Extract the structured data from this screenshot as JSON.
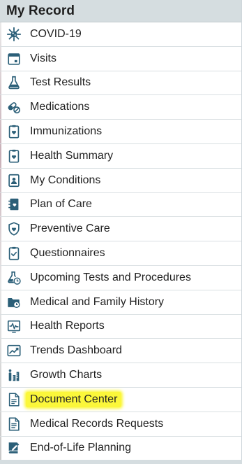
{
  "header": {
    "title": "My Record"
  },
  "colors": {
    "icon": "#2b5f78",
    "highlight": "#fbf73a",
    "header_bg": "#d5dde0"
  },
  "items": [
    {
      "label": "COVID-19",
      "icon": "virus-icon"
    },
    {
      "label": "Visits",
      "icon": "calendar-icon"
    },
    {
      "label": "Test Results",
      "icon": "flask-icon"
    },
    {
      "label": "Medications",
      "icon": "pills-icon"
    },
    {
      "label": "Immunizations",
      "icon": "clipboard-heart-icon"
    },
    {
      "label": "Health Summary",
      "icon": "clipboard-heart-icon"
    },
    {
      "label": "My Conditions",
      "icon": "person-card-icon"
    },
    {
      "label": "Plan of Care",
      "icon": "notebook-heart-icon"
    },
    {
      "label": "Preventive Care",
      "icon": "shield-heart-icon"
    },
    {
      "label": "Questionnaires",
      "icon": "checklist-icon"
    },
    {
      "label": "Upcoming Tests and Procedures",
      "icon": "flask-clock-icon"
    },
    {
      "label": "Medical and Family History",
      "icon": "folder-clock-icon"
    },
    {
      "label": "Health Reports",
      "icon": "pulse-chart-icon"
    },
    {
      "label": "Trends Dashboard",
      "icon": "trend-chart-icon"
    },
    {
      "label": "Growth Charts",
      "icon": "growth-bars-icon"
    },
    {
      "label": "Document Center",
      "icon": "document-icon",
      "highlighted": true
    },
    {
      "label": "Medical Records Requests",
      "icon": "document-lines-icon"
    },
    {
      "label": "End-of-Life Planning",
      "icon": "book-pen-icon"
    }
  ]
}
